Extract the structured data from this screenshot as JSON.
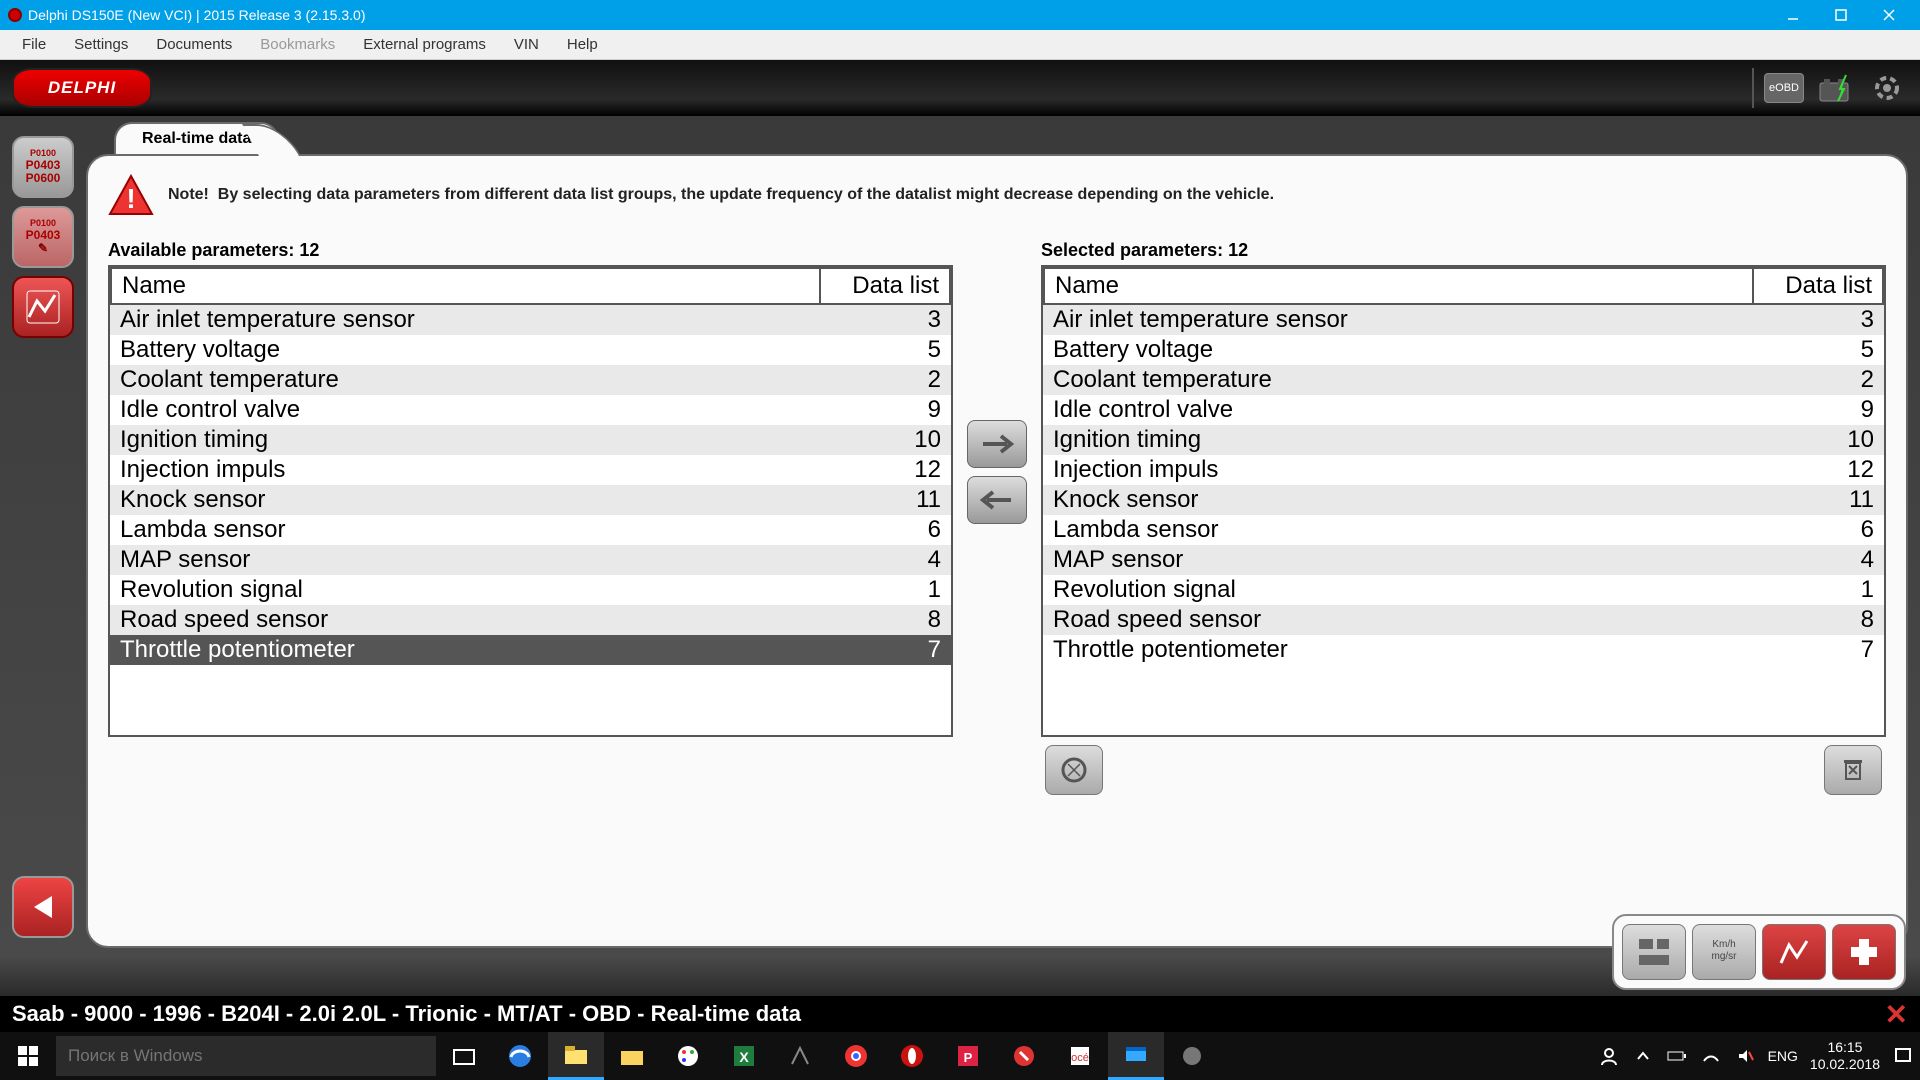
{
  "window": {
    "title": "Delphi DS150E (New VCI) | 2015 Release 3 (2.15.3.0)"
  },
  "menu": {
    "items": [
      "File",
      "Settings",
      "Documents",
      "Bookmarks",
      "External programs",
      "VIN",
      "Help"
    ],
    "disabled": [
      3
    ]
  },
  "header": {
    "brand": "DELPHI",
    "obd": "eOBD"
  },
  "tab": {
    "title": "Real-time data",
    "note_prefix": "Note!",
    "note_body": "By selecting data parameters from different data list groups, the update frequency of the datalist might decrease depending on the vehicle."
  },
  "lists": {
    "available_label": "Available parameters: 12",
    "selected_label": "Selected parameters: 12",
    "name_header": "Name",
    "datalist_header": "Data list",
    "rows": [
      {
        "name": "Air inlet temperature sensor",
        "dl": 3
      },
      {
        "name": "Battery voltage",
        "dl": 5
      },
      {
        "name": "Coolant temperature",
        "dl": 2
      },
      {
        "name": "Idle control valve",
        "dl": 9
      },
      {
        "name": "Ignition timing",
        "dl": 10
      },
      {
        "name": "Injection impuls",
        "dl": 12
      },
      {
        "name": "Knock sensor",
        "dl": 11
      },
      {
        "name": "Lambda sensor",
        "dl": 6
      },
      {
        "name": "MAP sensor",
        "dl": 4
      },
      {
        "name": "Revolution signal",
        "dl": 1
      },
      {
        "name": "Road speed sensor",
        "dl": 8
      },
      {
        "name": "Throttle potentiometer",
        "dl": 7
      }
    ],
    "available_selected_index": 11
  },
  "breadcrumb": "Saab - 9000 - 1996 - B204I - 2.0i 2.0L - Trionic - MT/AT - OBD - Real-time data",
  "taskbar": {
    "search_placeholder": "Поиск в Windows",
    "lang": "ENG",
    "time": "16:15",
    "date": "10.02.2018"
  },
  "sidebar": {
    "code1": "P0403",
    "code1_top": "P0100",
    "code1_bottom": "P0600",
    "code2": "P0403"
  }
}
